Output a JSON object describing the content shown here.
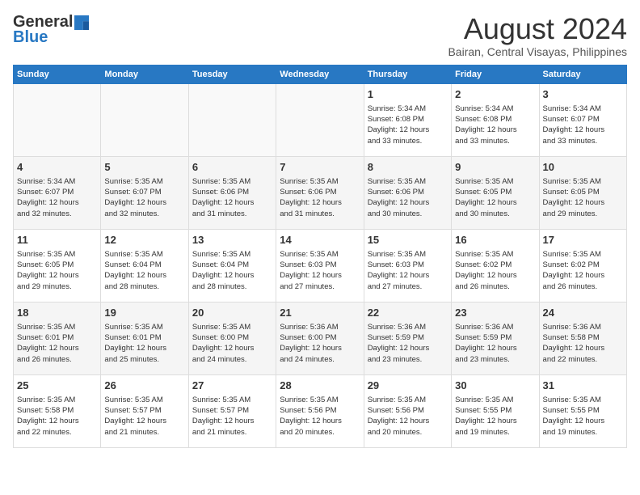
{
  "header": {
    "logo_general": "General",
    "logo_blue": "Blue",
    "month_title": "August 2024",
    "location": "Bairan, Central Visayas, Philippines"
  },
  "weekdays": [
    "Sunday",
    "Monday",
    "Tuesday",
    "Wednesday",
    "Thursday",
    "Friday",
    "Saturday"
  ],
  "weeks": [
    [
      {
        "day": "",
        "info": ""
      },
      {
        "day": "",
        "info": ""
      },
      {
        "day": "",
        "info": ""
      },
      {
        "day": "",
        "info": ""
      },
      {
        "day": "1",
        "info": "Sunrise: 5:34 AM\nSunset: 6:08 PM\nDaylight: 12 hours\nand 33 minutes."
      },
      {
        "day": "2",
        "info": "Sunrise: 5:34 AM\nSunset: 6:08 PM\nDaylight: 12 hours\nand 33 minutes."
      },
      {
        "day": "3",
        "info": "Sunrise: 5:34 AM\nSunset: 6:07 PM\nDaylight: 12 hours\nand 33 minutes."
      }
    ],
    [
      {
        "day": "4",
        "info": "Sunrise: 5:34 AM\nSunset: 6:07 PM\nDaylight: 12 hours\nand 32 minutes."
      },
      {
        "day": "5",
        "info": "Sunrise: 5:35 AM\nSunset: 6:07 PM\nDaylight: 12 hours\nand 32 minutes."
      },
      {
        "day": "6",
        "info": "Sunrise: 5:35 AM\nSunset: 6:06 PM\nDaylight: 12 hours\nand 31 minutes."
      },
      {
        "day": "7",
        "info": "Sunrise: 5:35 AM\nSunset: 6:06 PM\nDaylight: 12 hours\nand 31 minutes."
      },
      {
        "day": "8",
        "info": "Sunrise: 5:35 AM\nSunset: 6:06 PM\nDaylight: 12 hours\nand 30 minutes."
      },
      {
        "day": "9",
        "info": "Sunrise: 5:35 AM\nSunset: 6:05 PM\nDaylight: 12 hours\nand 30 minutes."
      },
      {
        "day": "10",
        "info": "Sunrise: 5:35 AM\nSunset: 6:05 PM\nDaylight: 12 hours\nand 29 minutes."
      }
    ],
    [
      {
        "day": "11",
        "info": "Sunrise: 5:35 AM\nSunset: 6:05 PM\nDaylight: 12 hours\nand 29 minutes."
      },
      {
        "day": "12",
        "info": "Sunrise: 5:35 AM\nSunset: 6:04 PM\nDaylight: 12 hours\nand 28 minutes."
      },
      {
        "day": "13",
        "info": "Sunrise: 5:35 AM\nSunset: 6:04 PM\nDaylight: 12 hours\nand 28 minutes."
      },
      {
        "day": "14",
        "info": "Sunrise: 5:35 AM\nSunset: 6:03 PM\nDaylight: 12 hours\nand 27 minutes."
      },
      {
        "day": "15",
        "info": "Sunrise: 5:35 AM\nSunset: 6:03 PM\nDaylight: 12 hours\nand 27 minutes."
      },
      {
        "day": "16",
        "info": "Sunrise: 5:35 AM\nSunset: 6:02 PM\nDaylight: 12 hours\nand 26 minutes."
      },
      {
        "day": "17",
        "info": "Sunrise: 5:35 AM\nSunset: 6:02 PM\nDaylight: 12 hours\nand 26 minutes."
      }
    ],
    [
      {
        "day": "18",
        "info": "Sunrise: 5:35 AM\nSunset: 6:01 PM\nDaylight: 12 hours\nand 26 minutes."
      },
      {
        "day": "19",
        "info": "Sunrise: 5:35 AM\nSunset: 6:01 PM\nDaylight: 12 hours\nand 25 minutes."
      },
      {
        "day": "20",
        "info": "Sunrise: 5:35 AM\nSunset: 6:00 PM\nDaylight: 12 hours\nand 24 minutes."
      },
      {
        "day": "21",
        "info": "Sunrise: 5:36 AM\nSunset: 6:00 PM\nDaylight: 12 hours\nand 24 minutes."
      },
      {
        "day": "22",
        "info": "Sunrise: 5:36 AM\nSunset: 5:59 PM\nDaylight: 12 hours\nand 23 minutes."
      },
      {
        "day": "23",
        "info": "Sunrise: 5:36 AM\nSunset: 5:59 PM\nDaylight: 12 hours\nand 23 minutes."
      },
      {
        "day": "24",
        "info": "Sunrise: 5:36 AM\nSunset: 5:58 PM\nDaylight: 12 hours\nand 22 minutes."
      }
    ],
    [
      {
        "day": "25",
        "info": "Sunrise: 5:35 AM\nSunset: 5:58 PM\nDaylight: 12 hours\nand 22 minutes."
      },
      {
        "day": "26",
        "info": "Sunrise: 5:35 AM\nSunset: 5:57 PM\nDaylight: 12 hours\nand 21 minutes."
      },
      {
        "day": "27",
        "info": "Sunrise: 5:35 AM\nSunset: 5:57 PM\nDaylight: 12 hours\nand 21 minutes."
      },
      {
        "day": "28",
        "info": "Sunrise: 5:35 AM\nSunset: 5:56 PM\nDaylight: 12 hours\nand 20 minutes."
      },
      {
        "day": "29",
        "info": "Sunrise: 5:35 AM\nSunset: 5:56 PM\nDaylight: 12 hours\nand 20 minutes."
      },
      {
        "day": "30",
        "info": "Sunrise: 5:35 AM\nSunset: 5:55 PM\nDaylight: 12 hours\nand 19 minutes."
      },
      {
        "day": "31",
        "info": "Sunrise: 5:35 AM\nSunset: 5:55 PM\nDaylight: 12 hours\nand 19 minutes."
      }
    ]
  ]
}
